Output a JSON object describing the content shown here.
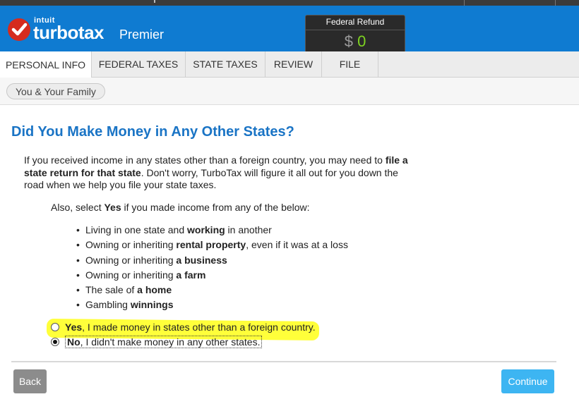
{
  "header": {
    "brand_small": "intuit",
    "brand": "turbotax",
    "edition": "Premier",
    "refund_label": "Federal Refund",
    "refund_currency": "$",
    "refund_amount": "0"
  },
  "tabs": [
    {
      "label": "PERSONAL INFO",
      "active": true
    },
    {
      "label": "FEDERAL TAXES",
      "active": false
    },
    {
      "label": "STATE TAXES",
      "active": false
    },
    {
      "label": "REVIEW",
      "active": false
    },
    {
      "label": "FILE",
      "active": false
    }
  ],
  "breadcrumb": "You & Your Family",
  "page": {
    "title": "Did You Make Money in Any Other States?",
    "intro_1": "If you received income in any states other than a foreign country, you may need to ",
    "intro_bold": "file a state return for that state",
    "intro_2": ". Don't worry, TurboTax will figure it all out for you down the road when we help you file your state taxes.",
    "also_1": "Also, select ",
    "also_bold": "Yes",
    "also_2": " if you made income from any of the below:"
  },
  "bullets": [
    {
      "pre": "Living in one state and ",
      "bold": "working",
      "post": " in another"
    },
    {
      "pre": "Owning or inheriting ",
      "bold": "rental property",
      "post": ", even if it was at a loss"
    },
    {
      "pre": "Owning or inheriting ",
      "bold": "a business",
      "post": ""
    },
    {
      "pre": "Owning or inheriting ",
      "bold": "a farm",
      "post": ""
    },
    {
      "pre": "The sale of ",
      "bold": "a home",
      "post": ""
    },
    {
      "pre": "Gambling ",
      "bold": "winnings",
      "post": ""
    }
  ],
  "options": {
    "yes_bold": "Yes",
    "yes_rest": ", I made money in states other than a foreign country.",
    "no_bold": "No",
    "no_rest": ", I didn't make money in any other states.",
    "selected": "no"
  },
  "buttons": {
    "back": "Back",
    "continue": "Continue"
  },
  "colors": {
    "header_blue": "#0f7bd1",
    "title_blue": "#1a74c5",
    "continue_blue": "#3db5f2",
    "back_gray": "#8c8c8c",
    "refund_green": "#7ed321",
    "highlight_yellow": "#ffff3a"
  }
}
